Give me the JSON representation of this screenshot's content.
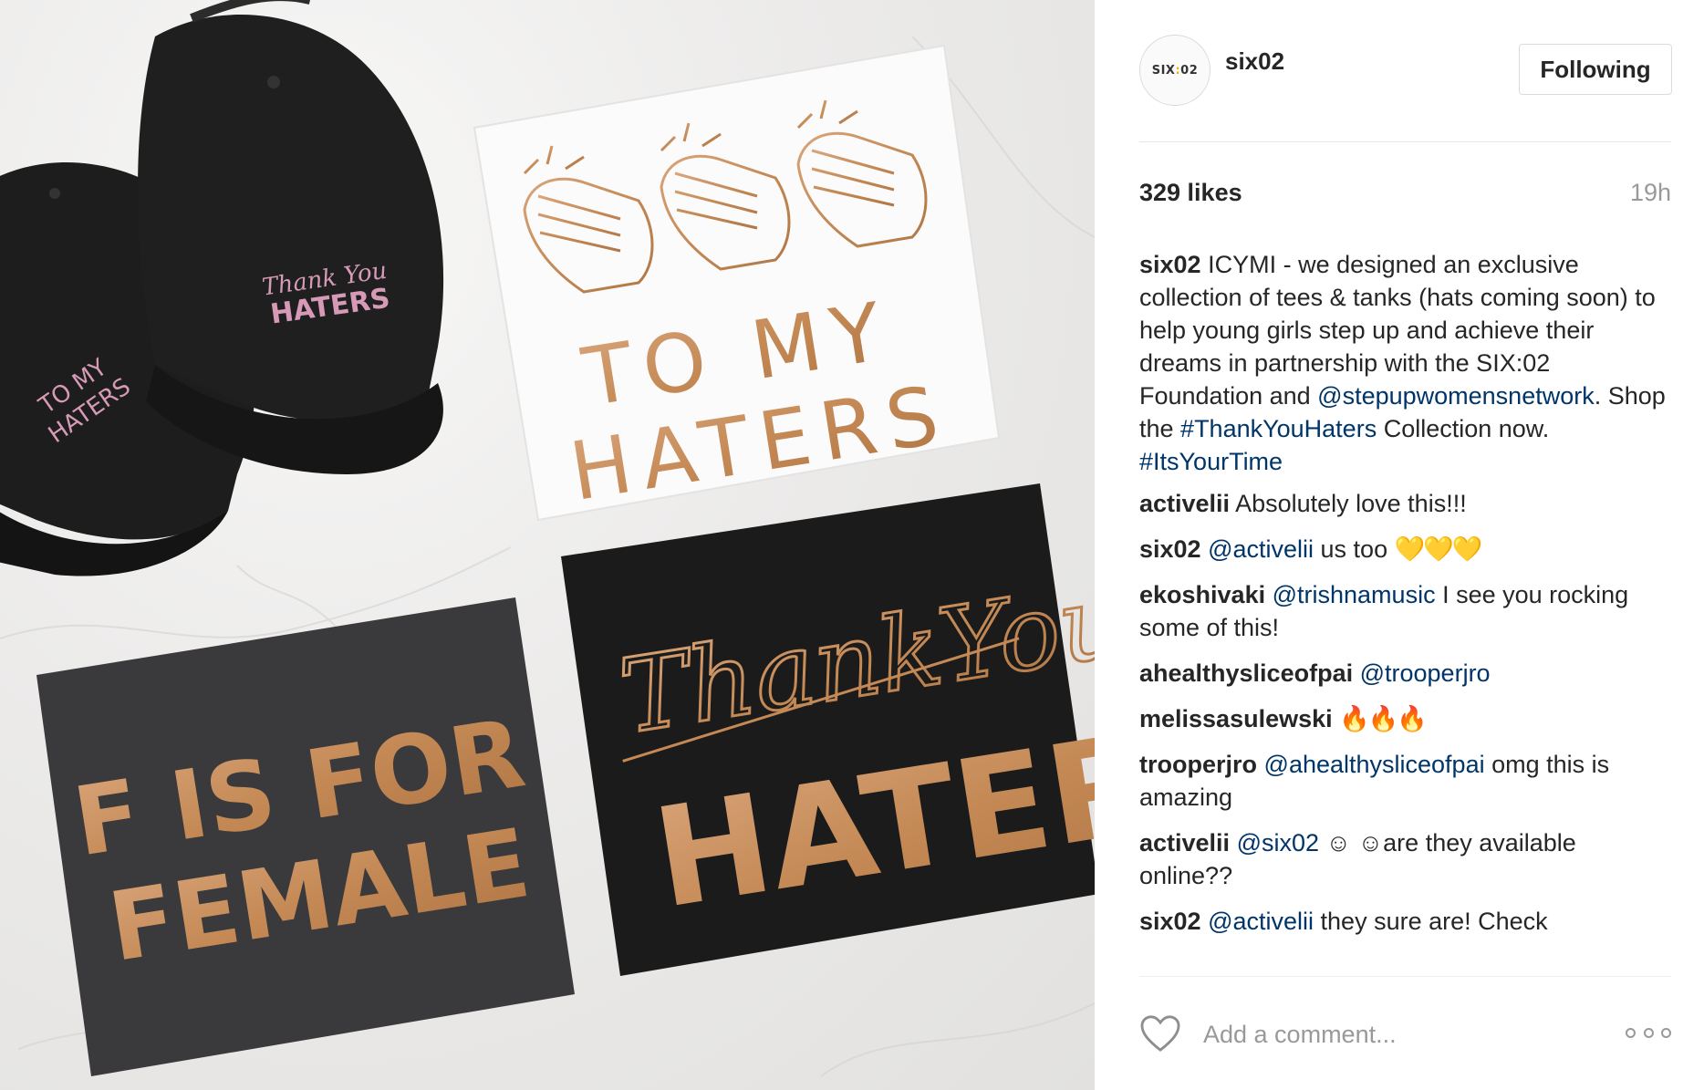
{
  "post_image": {
    "cap_left_text": [
      "TO MY",
      "HATERS"
    ],
    "cap_right_text": [
      "Thank You",
      "HATERS"
    ],
    "white_tee_text": [
      "TO MY",
      "HATERS"
    ],
    "grey_tee_text": [
      "F IS FOR",
      "FEMALE"
    ],
    "black_tee_script": "ThankYou",
    "black_tee_text": "HATERS",
    "colors": {
      "gold": "#c88e5a",
      "pink": "#d69ab7",
      "black": "#1c1c1c",
      "charcoal": "#3a3a3c",
      "white": "#fbfbfb"
    }
  },
  "header": {
    "avatar_text_left": "SIX",
    "avatar_text_dots": ":",
    "avatar_text_right": "02",
    "username": "six02",
    "follow_label": "Following"
  },
  "stats": {
    "likes": "329 likes",
    "time": "19h"
  },
  "comments": [
    {
      "user": "six02",
      "parts": [
        {
          "type": "text",
          "value": " ICYMI - we designed an exclusive collection of tees & tanks (hats coming soon) to help young girls step up and achieve their dreams in partnership with the SIX:02 Foundation and "
        },
        {
          "type": "link",
          "value": "@stepupwomensnetwork"
        },
        {
          "type": "text",
          "value": ". Shop the "
        },
        {
          "type": "link",
          "value": "#ThankYouHaters"
        },
        {
          "type": "text",
          "value": " Collection now. "
        },
        {
          "type": "link",
          "value": "#ItsYourTime"
        }
      ]
    },
    {
      "user": "activelii",
      "parts": [
        {
          "type": "text",
          "value": " Absolutely love this!!!"
        }
      ]
    },
    {
      "user": "six02",
      "parts": [
        {
          "type": "text",
          "value": " "
        },
        {
          "type": "link",
          "value": "@activelii"
        },
        {
          "type": "text",
          "value": " us too "
        },
        {
          "type": "emoji",
          "value": "💛💛💛",
          "style": "heart"
        }
      ]
    },
    {
      "user": "ekoshivaki",
      "parts": [
        {
          "type": "text",
          "value": " "
        },
        {
          "type": "link",
          "value": "@trishnamusic"
        },
        {
          "type": "text",
          "value": " I see you rocking some of this!"
        }
      ]
    },
    {
      "user": "ahealthysliceofpai",
      "parts": [
        {
          "type": "text",
          "value": " "
        },
        {
          "type": "link",
          "value": "@trooperjro"
        }
      ]
    },
    {
      "user": "melissasulewski",
      "parts": [
        {
          "type": "text",
          "value": " "
        },
        {
          "type": "emoji",
          "value": "🔥🔥🔥",
          "style": "fire"
        }
      ]
    },
    {
      "user": "trooperjro",
      "parts": [
        {
          "type": "text",
          "value": " "
        },
        {
          "type": "link",
          "value": "@ahealthysliceofpai"
        },
        {
          "type": "text",
          "value": " omg this is amazing"
        }
      ]
    },
    {
      "user": "activelii",
      "parts": [
        {
          "type": "text",
          "value": " "
        },
        {
          "type": "link",
          "value": "@six02"
        },
        {
          "type": "text",
          "value": " ☺ ☺are they available online??"
        }
      ]
    },
    {
      "user": "six02",
      "parts": [
        {
          "type": "text",
          "value": " "
        },
        {
          "type": "link",
          "value": "@activelii"
        },
        {
          "type": "text",
          "value": " they sure are! Check"
        }
      ]
    }
  ],
  "comment_bar": {
    "placeholder": "Add a comment...",
    "like_icon": "heart-outline-icon",
    "more_icon": "more-options-icon"
  }
}
